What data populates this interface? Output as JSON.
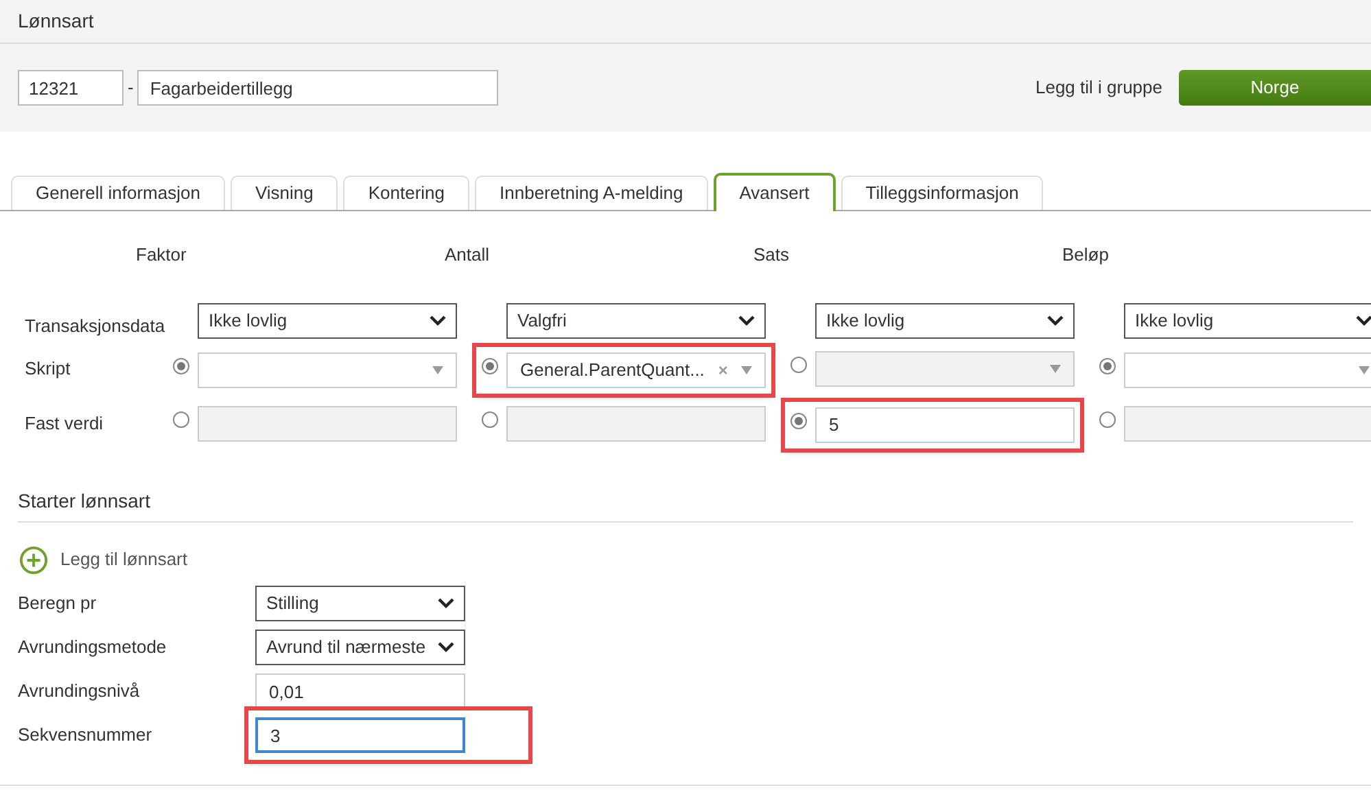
{
  "title": "Lønnsart",
  "header": {
    "code": "12321",
    "separator": "-",
    "name": "Fagarbeidertillegg",
    "group_label": "Legg til i gruppe",
    "group_button": "Norge"
  },
  "tabs": [
    {
      "label": "Generell informasjon",
      "selected": false
    },
    {
      "label": "Visning",
      "selected": false
    },
    {
      "label": "Kontering",
      "selected": false
    },
    {
      "label": "Innberetning A-melding",
      "selected": false
    },
    {
      "label": "Avansert",
      "selected": true
    },
    {
      "label": "Tilleggsinformasjon",
      "selected": false
    }
  ],
  "grid": {
    "columns": [
      "Faktor",
      "Antall",
      "Sats",
      "Beløp"
    ],
    "rows": [
      {
        "label": "Transaksjonsdata",
        "kind": "select",
        "cells": [
          {
            "value": "Ikke lovlig"
          },
          {
            "value": "Valgfri"
          },
          {
            "value": "Ikke lovlig"
          },
          {
            "value": "Ikke lovlig"
          }
        ]
      },
      {
        "label": "Skript",
        "kind": "combo",
        "cells": [
          {
            "selected": true,
            "disabled": false,
            "highlighted": false
          },
          {
            "selected": true,
            "disabled": false,
            "highlighted": true,
            "value": "General.ParentQuant...",
            "clear_icon": "×"
          },
          {
            "selected": false,
            "disabled": true,
            "highlighted": false
          },
          {
            "selected": true,
            "disabled": false,
            "highlighted": false
          }
        ]
      },
      {
        "label": "Fast verdi",
        "kind": "input",
        "cells": [
          {
            "selected": false,
            "disabled": true,
            "highlighted": false
          },
          {
            "selected": false,
            "disabled": true,
            "highlighted": false
          },
          {
            "selected": true,
            "disabled": false,
            "highlighted": true,
            "value": "5"
          },
          {
            "selected": false,
            "disabled": true,
            "highlighted": false
          }
        ]
      }
    ]
  },
  "section": {
    "title": "Starter lønnsart",
    "add_link": "Legg til lønnsart"
  },
  "form": [
    {
      "label": "Beregn pr",
      "kind": "select",
      "value": "Stilling",
      "highlighted": false
    },
    {
      "label": "Avrundingsmetode",
      "kind": "select",
      "value": "Avrund til nærmeste",
      "highlighted": false
    },
    {
      "label": "Avrundingsnivå",
      "kind": "input",
      "value": "0,01",
      "highlighted": false
    },
    {
      "label": "Sekvensnummer",
      "kind": "input",
      "value": "3",
      "highlighted": true,
      "focused": true
    }
  ]
}
